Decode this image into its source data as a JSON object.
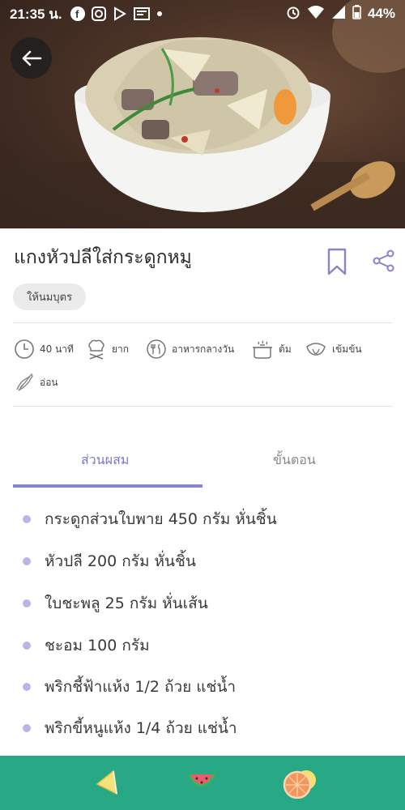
{
  "status_bar": {
    "time": "21:35 น.",
    "battery": "44%"
  },
  "recipe": {
    "title": "แกงหัวปลีใส่กระดูกหมู",
    "tag": "ให้นมบุตร",
    "info": {
      "time": "40 นาที",
      "difficulty": "ยาก",
      "meal": "อาหารกลางวัน",
      "method": "ต้ม",
      "taste": "เข้มข้น",
      "spice": "อ่อน"
    }
  },
  "tabs": {
    "ingredients": "ส่วนผสม",
    "steps": "ขั้นตอน"
  },
  "ingredients": [
    "กระดูกส่วนใบพาย 450 กรัม หั่นชิ้น",
    "หัวปลี 200 กรัม หั่นชิ้น",
    "ใบชะพลู 25 กรัม หั่นเส้น",
    "ชะอม 100 กรัม",
    "พริกชี้ฟ้าแห้ง 1/2 ถ้วย แช่น้ำ",
    "พริกขี้หนูแห้ง 1/4 ถ้วย แช่น้ำ"
  ],
  "colors": {
    "accent": "#7b78c8",
    "bottom_bar": "#27a985",
    "bullet": "#b9b6e6"
  },
  "icons": {
    "back": "back-arrow-icon",
    "bookmark": "bookmark-icon",
    "share": "share-icon",
    "bottom": [
      "lemon-icon",
      "watermelon-icon",
      "orange-icon"
    ]
  }
}
